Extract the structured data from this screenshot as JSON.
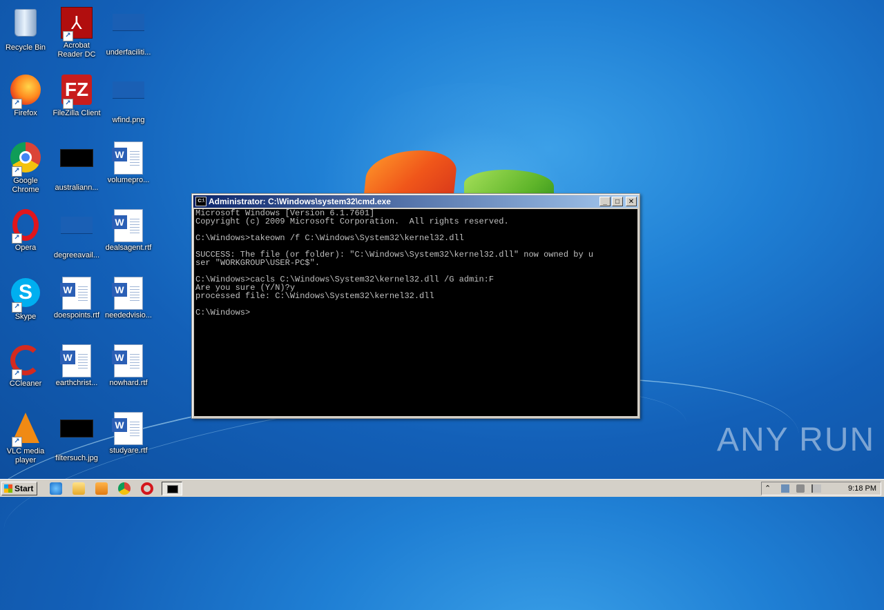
{
  "desktop": {
    "icons": [
      {
        "label": "Recycle Bin"
      },
      {
        "label": "Acrobat Reader DC"
      },
      {
        "label": "underfaciliti..."
      },
      {
        "label": "Firefox"
      },
      {
        "label": "FileZilla Client"
      },
      {
        "label": "wfind.png"
      },
      {
        "label": "Google Chrome"
      },
      {
        "label": "australiann..."
      },
      {
        "label": "volumepro..."
      },
      {
        "label": "Opera"
      },
      {
        "label": "degreeavail..."
      },
      {
        "label": "dealsagent.rtf"
      },
      {
        "label": "Skype"
      },
      {
        "label": "doespoints.rtf"
      },
      {
        "label": "neededvisio..."
      },
      {
        "label": "CCleaner"
      },
      {
        "label": "earthchrist..."
      },
      {
        "label": "nowhard.rtf"
      },
      {
        "label": "VLC media player"
      },
      {
        "label": "filtersuch.jpg"
      },
      {
        "label": "studyare.rtf"
      }
    ]
  },
  "cmd_window": {
    "title": "Administrator: C:\\Windows\\system32\\cmd.exe",
    "buttons": {
      "minimize": "_",
      "maximize": "□",
      "close": "✕"
    },
    "lines": [
      "Microsoft Windows [Version 6.1.7601]",
      "Copyright (c) 2009 Microsoft Corporation.  All rights reserved.",
      "",
      "C:\\Windows>takeown /f C:\\Windows\\System32\\kernel32.dll",
      "",
      "SUCCESS: The file (or folder): \"C:\\Windows\\System32\\kernel32.dll\" now owned by u",
      "ser \"WORKGROUP\\USER-PC$\".",
      "",
      "C:\\Windows>cacls C:\\Windows\\System32\\kernel32.dll /G admin:F",
      "Are you sure (Y/N)?y",
      "processed file: C:\\Windows\\System32\\kernel32.dll",
      "",
      "C:\\Windows>"
    ]
  },
  "taskbar": {
    "start_label": "Start",
    "clock": "9:18 PM"
  },
  "watermark": "ANY RUN",
  "colors": {
    "console_bg": "#000000",
    "console_fg": "#c0c0c0",
    "title_start": "#0a246a",
    "title_end": "#a6caf0"
  }
}
